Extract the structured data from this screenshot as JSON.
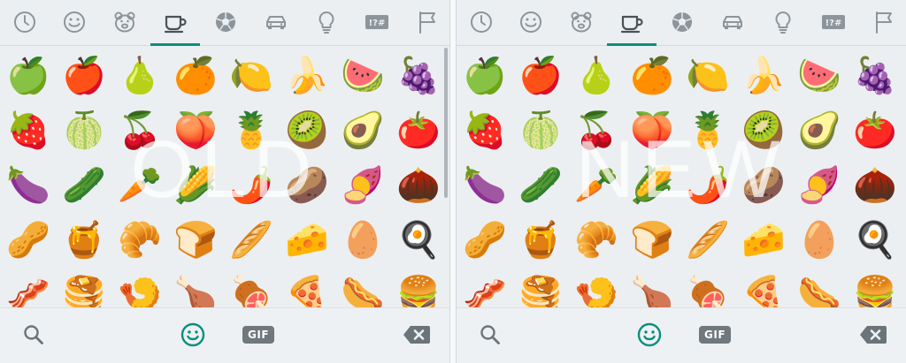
{
  "colors": {
    "accent": "#0b8f7e",
    "icon_gray": "#8c959b",
    "background": "#eceff1"
  },
  "panels": [
    {
      "watermark": "OLD",
      "tabs": [
        {
          "icon": "clock-icon"
        },
        {
          "icon": "smiley-icon"
        },
        {
          "icon": "bear-icon"
        },
        {
          "icon": "cup-icon",
          "active": true
        },
        {
          "icon": "soccer-ball-icon"
        },
        {
          "icon": "car-icon"
        },
        {
          "icon": "lightbulb-icon"
        },
        {
          "icon": "symbols-icon",
          "label": "!?#"
        },
        {
          "icon": "flag-icon"
        }
      ],
      "emoji_rows": [
        [
          "🍏",
          "🍎",
          "🍐",
          "🍊",
          "🍋",
          "🍌",
          "🍉",
          "🍇"
        ],
        [
          "🍓",
          "🍈",
          "🍒",
          "🍑",
          "🍍",
          "🥝",
          "🥑",
          "🍅"
        ],
        [
          "🍆",
          "🥒",
          "🥕",
          "🌽",
          "🌶️",
          "🥔",
          "🍠",
          "🌰"
        ],
        [
          "🥜",
          "🍯",
          "🥐",
          "🍞",
          "🥖",
          "🧀",
          "🥚",
          "🍳"
        ],
        [
          "🥓",
          "🥞",
          "🍤",
          "🍗",
          "🍖",
          "🍕",
          "🌭",
          "🍔"
        ]
      ],
      "bottom": {
        "gif_label": "GIF"
      }
    },
    {
      "watermark": "NEW",
      "tabs": [
        {
          "icon": "clock-icon"
        },
        {
          "icon": "smiley-icon"
        },
        {
          "icon": "bear-icon"
        },
        {
          "icon": "cup-icon",
          "active": true
        },
        {
          "icon": "soccer-ball-icon"
        },
        {
          "icon": "car-icon"
        },
        {
          "icon": "lightbulb-icon"
        },
        {
          "icon": "symbols-icon",
          "label": "!?#"
        },
        {
          "icon": "flag-icon"
        }
      ],
      "emoji_rows": [
        [
          "🍏",
          "🍎",
          "🍐",
          "🍊",
          "🍋",
          "🍌",
          "🍉",
          "🍇"
        ],
        [
          "🍓",
          "🍈",
          "🍒",
          "🍑",
          "🍍",
          "🥝",
          "🥑",
          "🍅"
        ],
        [
          "🍆",
          "🥒",
          "🥕",
          "🌽",
          "🌶️",
          "🥔",
          "🍠",
          "🌰"
        ],
        [
          "🥜",
          "🍯",
          "🥐",
          "🍞",
          "🥖",
          "🧀",
          "🥚",
          "🍳"
        ],
        [
          "🥓",
          "🥞",
          "🍤",
          "🍗",
          "🍖",
          "🍕",
          "🌭",
          "🍔"
        ]
      ],
      "bottom": {
        "gif_label": "GIF"
      }
    }
  ]
}
